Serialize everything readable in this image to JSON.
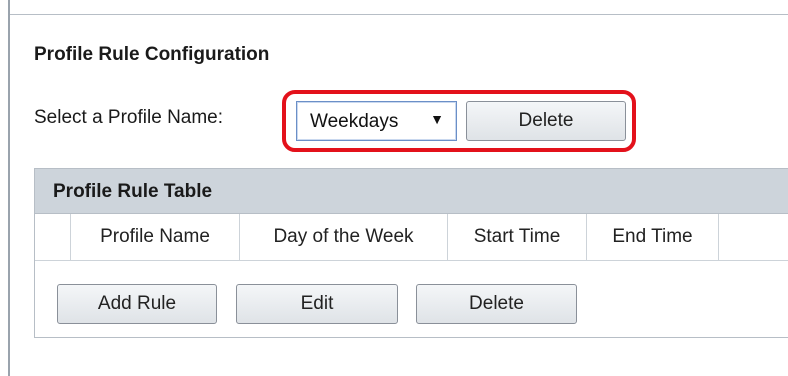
{
  "section": {
    "title": "Profile Rule Configuration",
    "select_label": "Select a Profile Name:",
    "selected_profile": "Weekdays",
    "delete_label": "Delete"
  },
  "table": {
    "title": "Profile Rule Table",
    "columns": [
      "",
      "Profile Name",
      "Day of the Week",
      "Start Time",
      "End Time",
      ""
    ],
    "rows": []
  },
  "actions": {
    "add_label": "Add Rule",
    "edit_label": "Edit",
    "delete_label": "Delete"
  },
  "colors": {
    "highlight": "#e3111b",
    "table_header_bg": "#cdd4db"
  },
  "icons": {
    "dropdown": "triangle-down"
  }
}
